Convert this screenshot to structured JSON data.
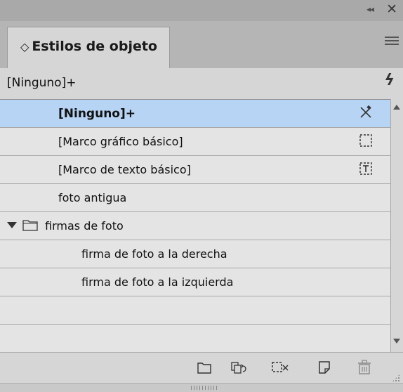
{
  "panel": {
    "collapse_icon": "double-chevron-left-icon",
    "close_icon": "close-icon",
    "tab": {
      "sort_glyph": "◇",
      "label": "Estilos de objeto"
    },
    "menu_icon": "hamburger-menu-icon",
    "current_style": "[Ninguno]+",
    "lightning_icon": "lightning-icon"
  },
  "list": {
    "items": [
      {
        "label": "[Ninguno]+",
        "selected": true,
        "icon": "cross-out-pen-icon"
      },
      {
        "label": "[Marco gráfico básico]",
        "icon": "dashed-frame-icon"
      },
      {
        "label": "[Marco de texto básico]",
        "icon": "text-frame-icon"
      },
      {
        "label": "foto antigua"
      },
      {
        "label": "firmas de foto",
        "group": true,
        "icon": "folder-icon"
      },
      {
        "label": "firma de foto a la derecha",
        "indent": 2
      },
      {
        "label": "firma de foto a la izquierda",
        "indent": 2
      }
    ]
  },
  "toolbar": {
    "buttons": [
      "new-group-icon",
      "load-styles-icon",
      "clear-overrides-icon",
      "new-style-icon",
      "delete-icon"
    ]
  },
  "colors": {
    "selection": "#b8d4f5",
    "panel": "#d6d6d6"
  }
}
